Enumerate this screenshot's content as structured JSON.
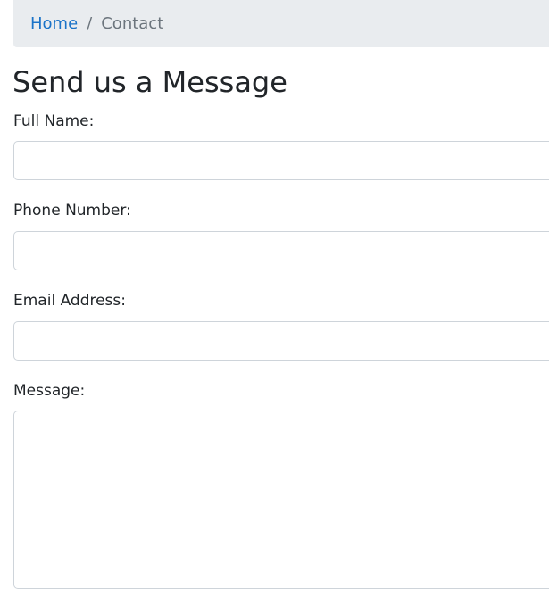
{
  "breadcrumb": {
    "home_label": "Home",
    "separator": "/",
    "current_label": "Contact"
  },
  "form": {
    "title": "Send us a Message",
    "full_name": {
      "label": "Full Name:",
      "value": ""
    },
    "phone": {
      "label": "Phone Number:",
      "value": ""
    },
    "email": {
      "label": "Email Address:",
      "value": ""
    },
    "message": {
      "label": "Message:",
      "value": ""
    }
  },
  "colors": {
    "link": "#1a73c8",
    "breadcrumb_bg": "#e9ecef",
    "muted_text": "#6c757d",
    "input_border": "#ced4da"
  }
}
